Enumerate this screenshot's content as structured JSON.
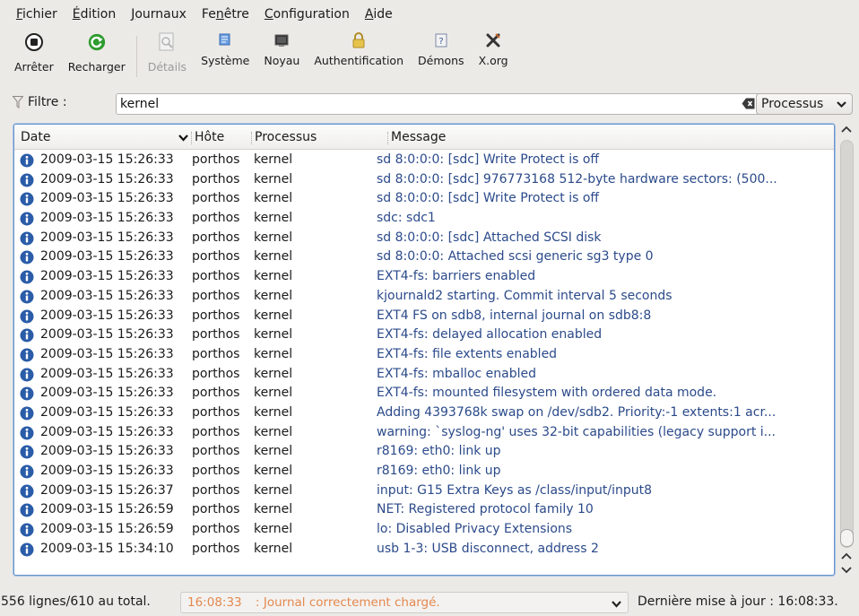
{
  "menubar": {
    "items": [
      {
        "pre": "",
        "mn": "F",
        "post": "ichier"
      },
      {
        "pre": "",
        "mn": "É",
        "post": "dition"
      },
      {
        "pre": "",
        "mn": "J",
        "post": "ournaux"
      },
      {
        "pre": "Fe",
        "mn": "n",
        "post": "être"
      },
      {
        "pre": "",
        "mn": "C",
        "post": "onfiguration"
      },
      {
        "pre": "",
        "mn": "A",
        "post": "ide"
      }
    ]
  },
  "toolbar": {
    "stop": "Arrêter",
    "reload": "Recharger",
    "details": "Détails",
    "system": "Système",
    "kernel": "Noyau",
    "auth": "Authentification",
    "daemons": "Démons",
    "xorg": "X.org"
  },
  "filter": {
    "label": "Filtre :",
    "value": "kernel",
    "scope": "Processus"
  },
  "log": {
    "columns": {
      "date": "Date",
      "host": "Hôte",
      "process": "Processus",
      "message": "Message"
    },
    "rows": [
      {
        "date": "2009-03-15 15:26:33",
        "host": "porthos",
        "process": "kernel",
        "message": "sd 8:0:0:0: [sdc] Write Protect is off"
      },
      {
        "date": "2009-03-15 15:26:33",
        "host": "porthos",
        "process": "kernel",
        "message": "sd 8:0:0:0: [sdc] 976773168 512-byte hardware sectors: (500..."
      },
      {
        "date": "2009-03-15 15:26:33",
        "host": "porthos",
        "process": "kernel",
        "message": "sd 8:0:0:0: [sdc] Write Protect is off"
      },
      {
        "date": "2009-03-15 15:26:33",
        "host": "porthos",
        "process": "kernel",
        "message": "sdc: sdc1"
      },
      {
        "date": "2009-03-15 15:26:33",
        "host": "porthos",
        "process": "kernel",
        "message": "sd 8:0:0:0: [sdc] Attached SCSI disk"
      },
      {
        "date": "2009-03-15 15:26:33",
        "host": "porthos",
        "process": "kernel",
        "message": "sd 8:0:0:0: Attached scsi generic sg3 type 0"
      },
      {
        "date": "2009-03-15 15:26:33",
        "host": "porthos",
        "process": "kernel",
        "message": "EXT4-fs: barriers enabled"
      },
      {
        "date": "2009-03-15 15:26:33",
        "host": "porthos",
        "process": "kernel",
        "message": "kjournald2 starting.  Commit interval 5 seconds"
      },
      {
        "date": "2009-03-15 15:26:33",
        "host": "porthos",
        "process": "kernel",
        "message": "EXT4 FS on sdb8, internal journal on sdb8:8"
      },
      {
        "date": "2009-03-15 15:26:33",
        "host": "porthos",
        "process": "kernel",
        "message": "EXT4-fs: delayed allocation enabled"
      },
      {
        "date": "2009-03-15 15:26:33",
        "host": "porthos",
        "process": "kernel",
        "message": "EXT4-fs: file extents enabled"
      },
      {
        "date": "2009-03-15 15:26:33",
        "host": "porthos",
        "process": "kernel",
        "message": "EXT4-fs: mballoc enabled"
      },
      {
        "date": "2009-03-15 15:26:33",
        "host": "porthos",
        "process": "kernel",
        "message": "EXT4-fs: mounted filesystem with ordered data mode."
      },
      {
        "date": "2009-03-15 15:26:33",
        "host": "porthos",
        "process": "kernel",
        "message": "Adding 4393768k swap on /dev/sdb2.  Priority:-1 extents:1 acr..."
      },
      {
        "date": "2009-03-15 15:26:33",
        "host": "porthos",
        "process": "kernel",
        "message": "warning: `syslog-ng' uses 32-bit capabilities (legacy support i..."
      },
      {
        "date": "2009-03-15 15:26:33",
        "host": "porthos",
        "process": "kernel",
        "message": "r8169: eth0: link up"
      },
      {
        "date": "2009-03-15 15:26:33",
        "host": "porthos",
        "process": "kernel",
        "message": "r8169: eth0: link up"
      },
      {
        "date": "2009-03-15 15:26:37",
        "host": "porthos",
        "process": "kernel",
        "message": "input: G15 Extra Keys as /class/input/input8"
      },
      {
        "date": "2009-03-15 15:26:59",
        "host": "porthos",
        "process": "kernel",
        "message": "NET: Registered protocol family 10"
      },
      {
        "date": "2009-03-15 15:26:59",
        "host": "porthos",
        "process": "kernel",
        "message": "lo: Disabled Privacy Extensions"
      },
      {
        "date": "2009-03-15 15:34:10",
        "host": "porthos",
        "process": "kernel",
        "message": "usb 1-3: USB disconnect, address 2"
      }
    ]
  },
  "status": {
    "count": "556 lignes/610 au total.",
    "time": "16:08:33",
    "message": ": Journal correctement chargé.",
    "last_update": "Dernière mise à jour  : 16:08:33."
  },
  "colors": {
    "message_text": "#2b4a8a",
    "status_text": "#e4884f",
    "info_icon": "#2a5ca8",
    "reload_green": "#2e9b2e",
    "focus_border": "#6a93c9"
  },
  "icons": {
    "stop": "stop-icon",
    "reload": "reload-icon",
    "details": "details-icon",
    "system": "system-icon",
    "kernel": "kernel-icon",
    "auth": "lock-icon",
    "daemons": "daemons-icon",
    "xorg": "xorg-icon",
    "filter": "funnel-icon",
    "clear": "clear-text-icon",
    "row": "info-icon"
  }
}
